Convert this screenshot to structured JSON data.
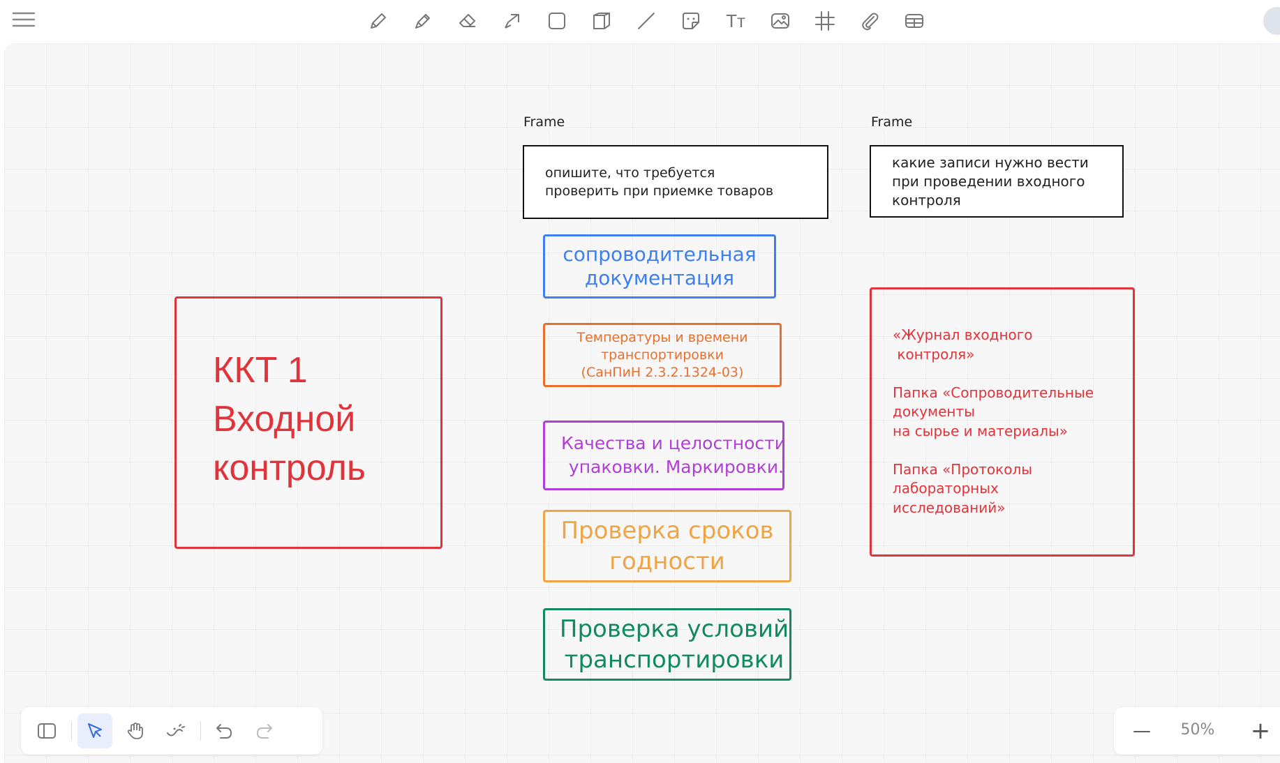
{
  "toolbar": {
    "tools": [
      "pencil-icon",
      "pen-icon",
      "eraser-icon",
      "arrow-icon",
      "rectangle-icon",
      "frame-3d-icon",
      "line-icon",
      "sticker-icon",
      "text-icon",
      "image-icon",
      "frame-grid-icon",
      "attachment-icon",
      "table-icon"
    ],
    "text_tool_label": "Tт"
  },
  "canvas": {
    "frame1_label": "Frame",
    "frame2_label": "Frame",
    "prompt1": "опишите, что требуется\nпроверить при приемке товаров",
    "prompt2": "какие записи нужно вести\nпри проведении входного\nконтроля",
    "title_card": "ККТ 1\nВходной\nконтроль",
    "items": [
      {
        "text": "сопроводительная\nдокументация",
        "color": "#3d7ff0"
      },
      {
        "text": "Температуры и времени\n транспортировки\n(СанПиН 2.3.2.1324-03)",
        "color": "#e8702e"
      },
      {
        "text": "Качества и целостности\n упаковки. Маркировки.",
        "color": "#b03fd6"
      },
      {
        "text": "Проверка сроков\n годности",
        "color": "#f0a545"
      },
      {
        "text": "Проверка условий\nтранспортировки",
        "color": "#138a5e"
      }
    ],
    "records_card": "«Журнал входного\n контроля»\n\nПапка «Сопроводительные\nдокументы\nна сырье и материалы»\n\nПапка «Протоколы\nлабораторных\nисследований»",
    "red_color": "#e0343a"
  },
  "zoom": {
    "minus": "—",
    "level": "50%",
    "plus": "+"
  }
}
